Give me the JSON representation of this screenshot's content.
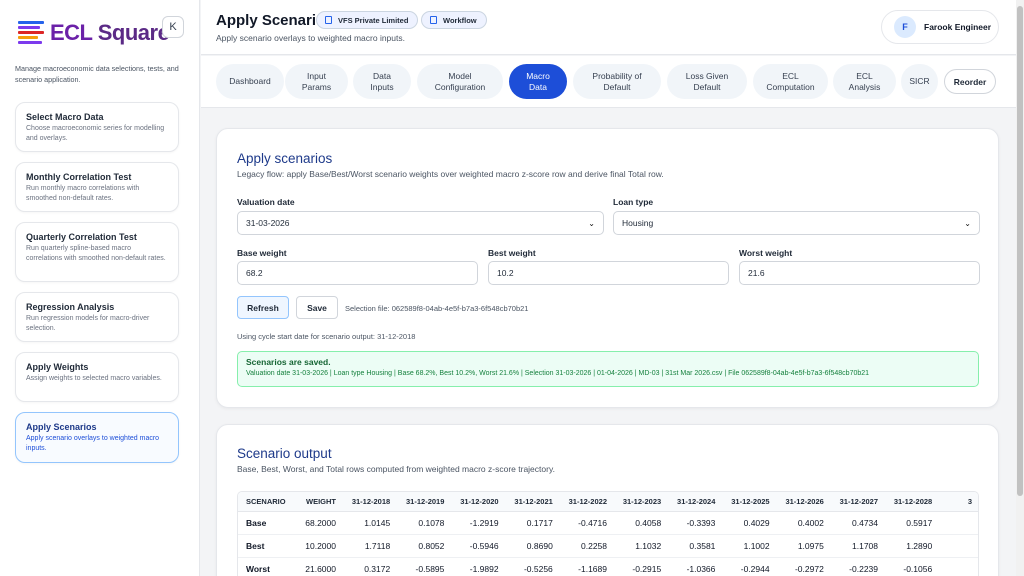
{
  "app": {
    "name_part1": "ECL",
    "name_part2": "Square",
    "collapse_icon": "K"
  },
  "sidebar": {
    "description": "Manage macroeconomic data selections, tests, and scenario application.",
    "items": [
      {
        "title": "Select Macro Data",
        "desc": "Choose macroeconomic series for modelling and overlays."
      },
      {
        "title": "Monthly Correlation Test",
        "desc": "Run monthly macro correlations with smoothed non-default rates."
      },
      {
        "title": "Quarterly Correlation Test",
        "desc": "Run quarterly spline-based macro correlations with smoothed non-default rates."
      },
      {
        "title": "Regression Analysis",
        "desc": "Run regression models for macro-driver selection."
      },
      {
        "title": "Apply Weights",
        "desc": "Assign weights to selected macro variables."
      },
      {
        "title": "Apply Scenarios",
        "desc": "Apply scenario overlays to weighted macro inputs."
      }
    ]
  },
  "header": {
    "title": "Apply Scenarios",
    "subtitle": "Apply scenario overlays to weighted macro inputs.",
    "chips": [
      "VFS Private Limited",
      "Workflow"
    ],
    "user": {
      "initial": "F",
      "name": "Farook Engineer"
    }
  },
  "tabs": [
    "Dashboard",
    "Input\nParams",
    "Data\nInputs",
    "Model\nConfiguration",
    "Macro\nData",
    "Probability of\nDefault",
    "Loss Given\nDefault",
    "ECL\nComputation",
    "ECL\nAnalysis",
    "SICR"
  ],
  "reorder_label": "Reorder",
  "apply": {
    "title": "Apply scenarios",
    "subtitle": "Legacy flow: apply Base/Best/Worst scenario weights over weighted macro z-score row and derive final Total row.",
    "valuation_label": "Valuation date",
    "valuation_value": "31-03-2026",
    "loan_label": "Loan type",
    "loan_value": "Housing",
    "base_label": "Base weight",
    "base_value": "68.2",
    "best_label": "Best weight",
    "best_value": "10.2",
    "worst_label": "Worst weight",
    "worst_value": "21.6",
    "refresh_label": "Refresh",
    "save_label": "Save",
    "selection_file": "Selection file: 062589f8-04ab-4e5f-b7a3-6f548cb70b21",
    "cycle_note": "Using cycle start date for scenario output: 31-12-2018",
    "success_title": "Scenarios are saved.",
    "success_detail": "Valuation date 31-03-2026 | Loan type Housing | Base 68.2%, Best 10.2%, Worst 21.6% | Selection 31-03-2026 | 01-04-2026 | MD-03 | 31st Mar 2026.csv | File 062589f8-04ab-4e5f-b7a3-6f548cb70b21"
  },
  "output": {
    "title": "Scenario output",
    "subtitle": "Base, Best, Worst, and Total rows computed from weighted macro z-score trajectory.",
    "columns": [
      "SCENARIO",
      "WEIGHT",
      "31-12-2018",
      "31-12-2019",
      "31-12-2020",
      "31-12-2021",
      "31-12-2022",
      "31-12-2023",
      "31-12-2024",
      "31-12-2025",
      "31-12-2026",
      "31-12-2027",
      "31-12-2028",
      "3"
    ],
    "rows": [
      [
        "Base",
        "68.2000",
        "1.0145",
        "0.1078",
        "-1.2919",
        "0.1717",
        "-0.4716",
        "0.4058",
        "-0.3393",
        "0.4029",
        "0.4002",
        "0.4734",
        "0.5917",
        ""
      ],
      [
        "Best",
        "10.2000",
        "1.7118",
        "0.8052",
        "-0.5946",
        "0.8690",
        "0.2258",
        "1.1032",
        "0.3581",
        "1.1002",
        "1.0975",
        "1.1708",
        "1.2890",
        ""
      ],
      [
        "Worst",
        "21.6000",
        "0.3172",
        "-0.5895",
        "-1.9892",
        "-0.5256",
        "-1.1689",
        "-0.2915",
        "-1.0366",
        "-0.2944",
        "-0.2972",
        "-0.2239",
        "-0.1056",
        ""
      ]
    ]
  }
}
